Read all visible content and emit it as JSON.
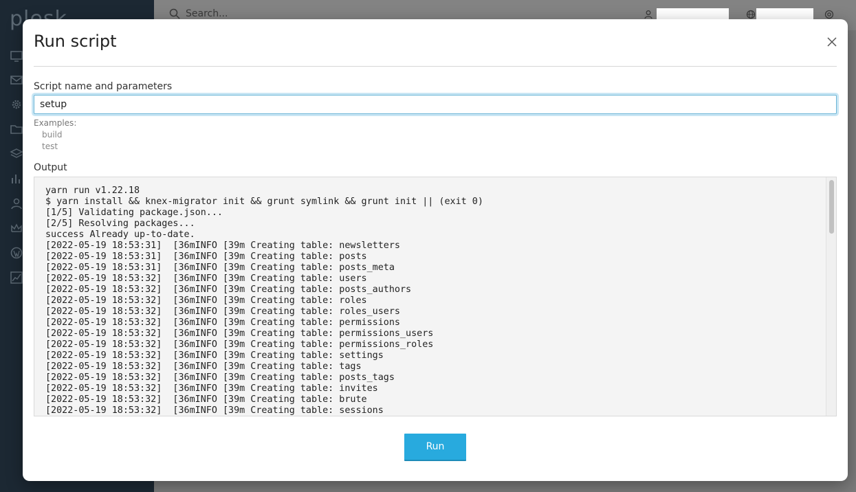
{
  "background": {
    "logo": "plesk",
    "search_placeholder": "Search..."
  },
  "modal": {
    "title": "Run script",
    "script_label": "Script name and parameters",
    "script_value": "setup",
    "examples_label": "Examples:",
    "examples": [
      "build",
      "test"
    ],
    "output_label": "Output",
    "output_lines": [
      "yarn run v1.22.18",
      "$ yarn install && knex-migrator init && grunt symlink && grunt init || (exit 0)",
      "[1/5] Validating package.json...",
      "[2/5] Resolving packages...",
      "success Already up-to-date.",
      "[2022-05-19 18:53:31]  [36mINFO [39m Creating table: newsletters",
      "[2022-05-19 18:53:31]  [36mINFO [39m Creating table: posts",
      "[2022-05-19 18:53:31]  [36mINFO [39m Creating table: posts_meta",
      "[2022-05-19 18:53:32]  [36mINFO [39m Creating table: users",
      "[2022-05-19 18:53:32]  [36mINFO [39m Creating table: posts_authors",
      "[2022-05-19 18:53:32]  [36mINFO [39m Creating table: roles",
      "[2022-05-19 18:53:32]  [36mINFO [39m Creating table: roles_users",
      "[2022-05-19 18:53:32]  [36mINFO [39m Creating table: permissions",
      "[2022-05-19 18:53:32]  [36mINFO [39m Creating table: permissions_users",
      "[2022-05-19 18:53:32]  [36mINFO [39m Creating table: permissions_roles",
      "[2022-05-19 18:53:32]  [36mINFO [39m Creating table: settings",
      "[2022-05-19 18:53:32]  [36mINFO [39m Creating table: tags",
      "[2022-05-19 18:53:32]  [36mINFO [39m Creating table: posts_tags",
      "[2022-05-19 18:53:32]  [36mINFO [39m Creating table: invites",
      "[2022-05-19 18:53:32]  [36mINFO [39m Creating table: brute",
      "[2022-05-19 18:53:32]  [36mINFO [39m Creating table: sessions"
    ],
    "run_label": "Run"
  },
  "colors": {
    "accent": "#28aade",
    "sidebar": "#1c2833"
  }
}
